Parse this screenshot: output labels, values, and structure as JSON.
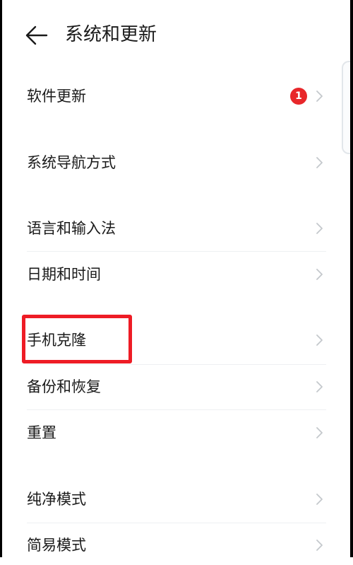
{
  "header": {
    "title": "系统和更新"
  },
  "badge_color": "#e8272a",
  "highlight_color": "#ee1c25",
  "items": [
    {
      "label": "软件更新",
      "badge": "1"
    },
    {
      "label": "系统导航方式"
    },
    {
      "label": "语言和输入法"
    },
    {
      "label": "日期和时间"
    },
    {
      "label": "手机克隆",
      "highlighted": true
    },
    {
      "label": "备份和恢复"
    },
    {
      "label": "重置"
    },
    {
      "label": "纯净模式"
    },
    {
      "label": "简易模式"
    }
  ]
}
